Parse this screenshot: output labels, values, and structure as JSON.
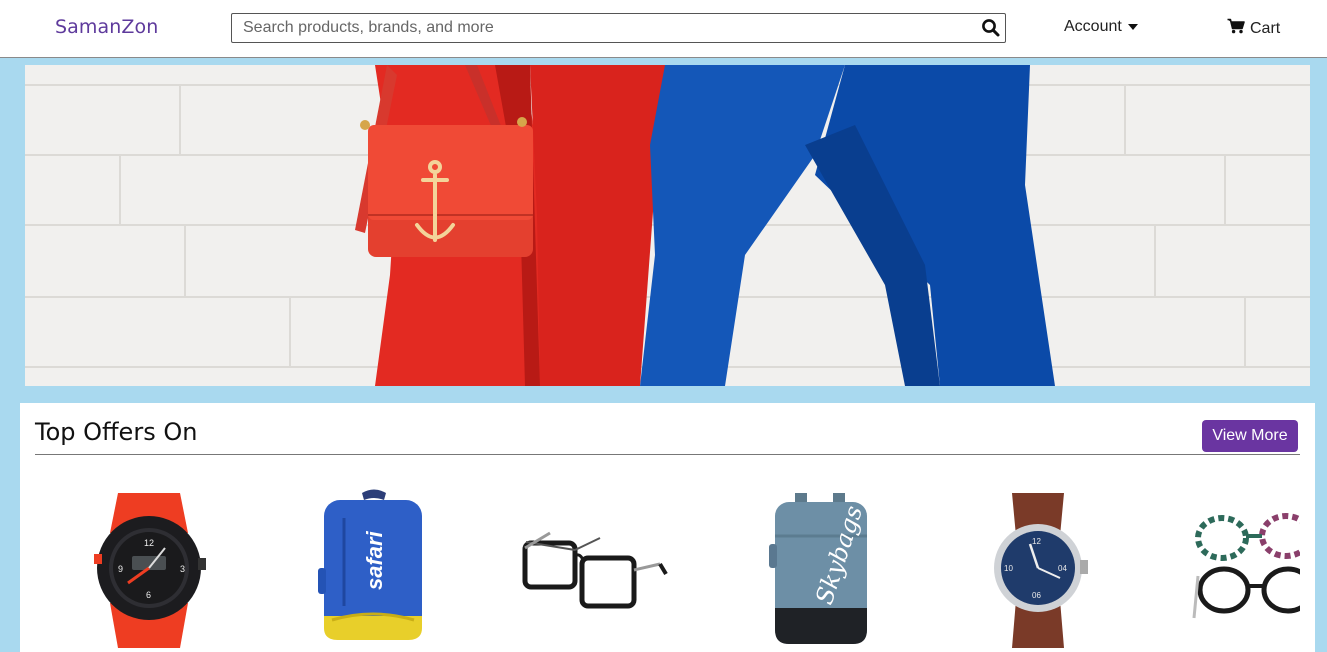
{
  "header": {
    "brand_first": "Saman",
    "brand_second": "Zon",
    "search_placeholder": "Search products, brands, and more",
    "account_label": "Account",
    "cart_label": "Cart"
  },
  "offers": {
    "title": "Top Offers On",
    "view_more_label": "View More",
    "products": [
      {
        "icon": "sports-watch-icon"
      },
      {
        "icon": "blue-backpack-icon"
      },
      {
        "icon": "eyeglasses-icon"
      },
      {
        "icon": "grey-backpack-icon"
      },
      {
        "icon": "analog-watch-icon"
      },
      {
        "icon": "floral-eyeglasses-icon"
      }
    ]
  },
  "colors": {
    "brand": "#5e3a9c",
    "accent_button": "#6a35a1",
    "page_background": "#a9d9ef"
  }
}
